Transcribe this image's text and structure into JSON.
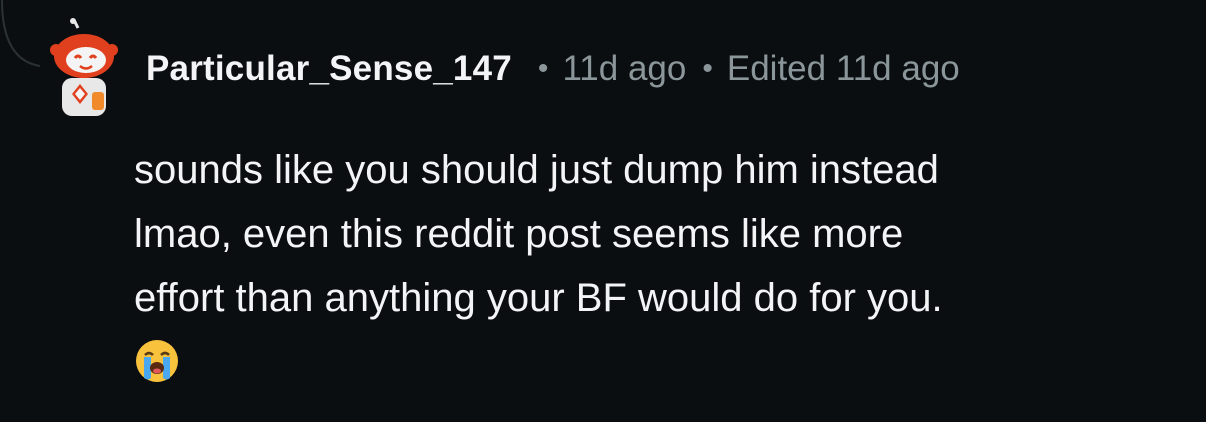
{
  "comment": {
    "author": "Particular_Sense_147",
    "separator": "•",
    "time": "11d ago",
    "edited": "Edited 11d ago",
    "body_lines": [
      "sounds like you should just dump him instead",
      "lmao, even this reddit post seems like more",
      "effort than anything your BF would do for you."
    ],
    "emoji": "loudly-crying-face-emoji"
  },
  "colors": {
    "background": "#0b0e10",
    "text": "#f2f4f5",
    "meta": "#8b969b",
    "avatar_primary": "#e0401e"
  }
}
